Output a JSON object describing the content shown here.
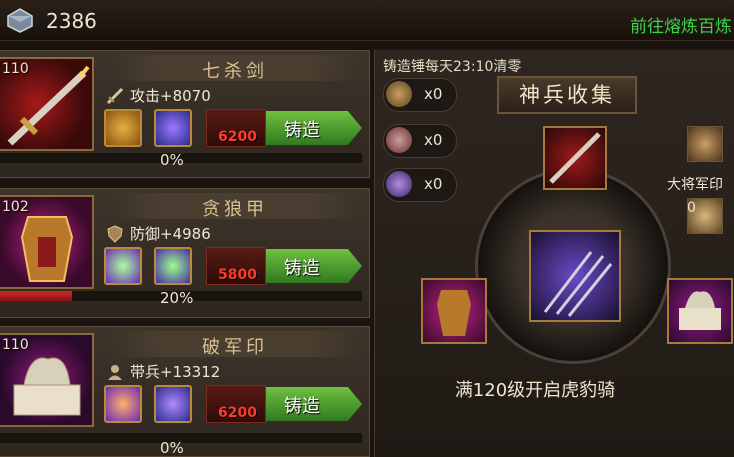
{
  "resource": {
    "icon": "iron-ore-icon",
    "amount": "2386"
  },
  "goto_link": "前往熔炼百炼",
  "equipment": [
    {
      "level": "110",
      "name": "七杀剑",
      "stat_icon": "sword-icon",
      "stat": "攻击+8070",
      "cost": "6200",
      "forge_label": "铸造",
      "progress_text": "0%",
      "progress": 0
    },
    {
      "level": "102",
      "name": "贪狼甲",
      "stat_icon": "shield-icon",
      "stat": "防御+4986",
      "cost": "5800",
      "forge_label": "铸造",
      "progress_text": "20%",
      "progress": 0.2
    },
    {
      "level": "110",
      "name": "破军印",
      "stat_icon": "general-icon",
      "stat": "带兵+13312",
      "cost": "6200",
      "forge_label": "铸造",
      "progress_text": "0%",
      "progress": 0
    }
  ],
  "panel": {
    "reset_text": "铸造锤每天23:10清零",
    "title": "神兵收集",
    "hammers": [
      {
        "icon": "bronze-hammer-icon",
        "count": "x0"
      },
      {
        "icon": "silver-hammer-icon",
        "count": "x0"
      },
      {
        "icon": "purple-hammer-icon",
        "count": "x0"
      }
    ],
    "side_label_top": "大将军印",
    "side_count": "0",
    "unlock_text": "满120级开启虎豹骑"
  },
  "colors": {
    "forge_green": "#4fa030",
    "cost_red": "#ff3a2a",
    "goto_green": "#3ad24a",
    "progress_red": "#d22a2a"
  }
}
